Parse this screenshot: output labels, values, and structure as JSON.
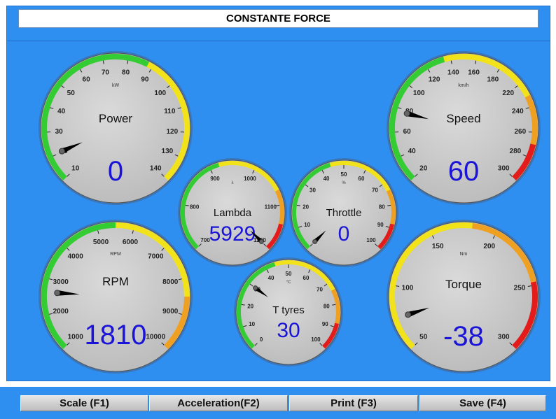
{
  "title": "CONSTANTE FORCE",
  "colors": {
    "panel": "#2f8ff1",
    "dial_face": "#c9c9c9",
    "value_text": "#1a14d8",
    "needle": "#000000",
    "arc_green": "#33cc33",
    "arc_yellow": "#f2e21a",
    "arc_orange": "#f0a020",
    "arc_red": "#e41b1b"
  },
  "gauges": [
    {
      "id": "power",
      "label": "Power",
      "unit": "kW",
      "value": "0",
      "ticks": [
        "10",
        "20",
        "30",
        "40",
        "50",
        "60",
        "70",
        "80",
        "90",
        "100",
        "110",
        "120",
        "130",
        "140"
      ],
      "needle_fraction": 0.08,
      "zones": [
        "green",
        "yellow"
      ]
    },
    {
      "id": "speed",
      "label": "Speed",
      "unit": "km/h",
      "value": "60",
      "ticks": [
        "20",
        "40",
        "60",
        "80",
        "100",
        "120",
        "140",
        "160",
        "180",
        "220",
        "240",
        "260",
        "280",
        "300"
      ],
      "needle_fraction": 0.22,
      "zones": [
        "green",
        "yellow",
        "orange",
        "red"
      ]
    },
    {
      "id": "lambda",
      "label": "Lambda",
      "unit": "λ",
      "value": "5929",
      "ticks": [
        "700",
        "800",
        "900",
        "1000",
        "1100",
        "1200"
      ],
      "needle_fraction": 1.0,
      "zones": [
        "green",
        "yellow",
        "orange",
        "red"
      ]
    },
    {
      "id": "throttle",
      "label": "Throttle",
      "unit": "%",
      "value": "0",
      "ticks": [
        "0",
        "10",
        "20",
        "30",
        "40",
        "50",
        "60",
        "70",
        "80",
        "90",
        "100"
      ],
      "needle_fraction": 0.0,
      "zones": [
        "green",
        "yellow",
        "orange",
        "red"
      ]
    },
    {
      "id": "rpm",
      "label": "RPM",
      "unit": "RPM",
      "value": "1810",
      "ticks": [
        "1000",
        "2000",
        "3000",
        "4000",
        "5000",
        "6000",
        "7000",
        "8000",
        "9000",
        "10000"
      ],
      "needle_fraction": 0.18,
      "zones": [
        "green",
        "yellow",
        "orange"
      ]
    },
    {
      "id": "ttyres",
      "label": "T tyres",
      "unit": "°C",
      "value": "30",
      "ticks": [
        "0",
        "10",
        "20",
        "30",
        "40",
        "50",
        "60",
        "70",
        "80",
        "90",
        "100"
      ],
      "needle_fraction": 0.3,
      "zones": [
        "green",
        "yellow",
        "orange",
        "red"
      ]
    },
    {
      "id": "torque",
      "label": "Torque",
      "unit": "Nm",
      "value": "-38",
      "ticks": [
        "50",
        "100",
        "150",
        "200",
        "250",
        "300"
      ],
      "needle_fraction": 0.1,
      "zones": [
        "yellow",
        "orange",
        "red"
      ]
    }
  ],
  "buttons": [
    {
      "id": "scale",
      "label": "Scale (F1)"
    },
    {
      "id": "acceleration",
      "label": "Acceleration(F2)"
    },
    {
      "id": "print",
      "label": "Print (F3)"
    },
    {
      "id": "save",
      "label": "Save (F4)"
    }
  ]
}
